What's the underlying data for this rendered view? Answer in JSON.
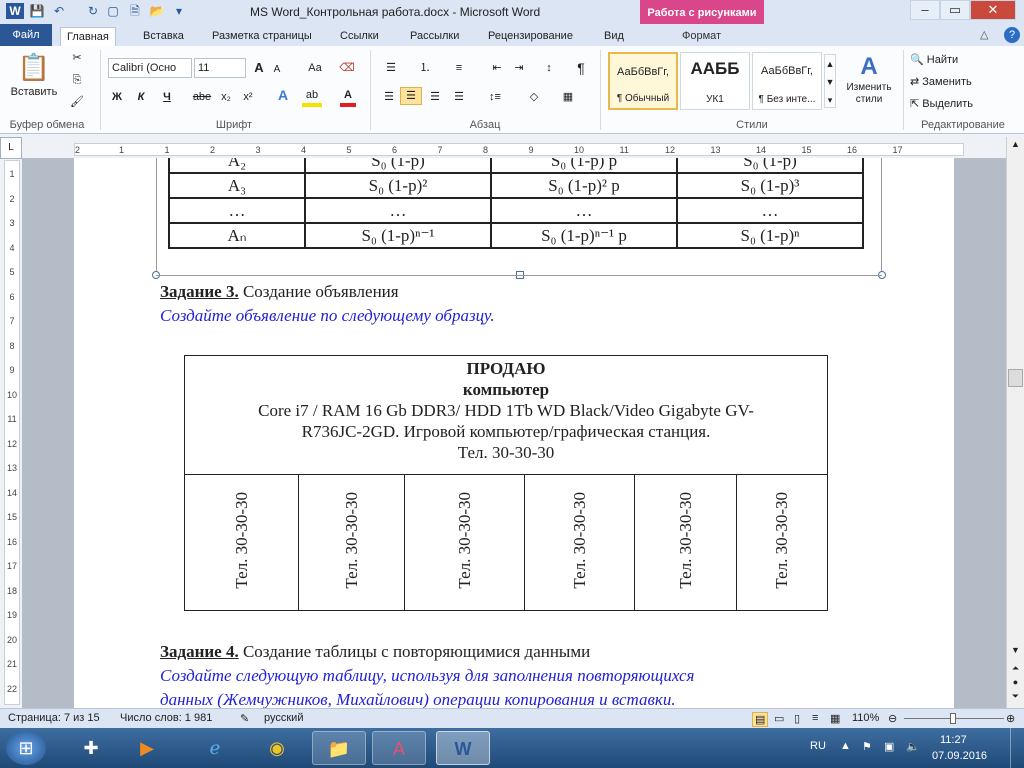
{
  "window": {
    "title": "MS Word_Контрольная работа.docx - Microsoft Word",
    "context_group": "Работа с рисунками",
    "min": "–",
    "max": "▭",
    "close": "✕"
  },
  "tabs": [
    "Файл",
    "Главная",
    "Вставка",
    "Разметка страницы",
    "Ссылки",
    "Рассылки",
    "Рецензирование",
    "Вид",
    "Формат"
  ],
  "ribbon": {
    "clipboard": {
      "label": "Буфер обмена",
      "paste": "Вставить"
    },
    "font": {
      "label": "Шрифт",
      "name": "Calibri (Осно",
      "size": "11",
      "bold": "Ж",
      "italic": "К",
      "underline": "Ч",
      "strike": "abe",
      "sub": "x₂",
      "sup": "x²",
      "case": "Aa",
      "grow": "A",
      "shrink": "A"
    },
    "paragraph": {
      "label": "Абзац",
      "pilcrow": "¶"
    },
    "styles": {
      "label": "Стили",
      "items": [
        {
          "preview": "АаБбВвГг,",
          "name": "¶ Обычный"
        },
        {
          "preview": "ААББ",
          "name": "УК1"
        },
        {
          "preview": "АаБбВвГг,",
          "name": "¶ Без инте..."
        }
      ],
      "change": "Изменить стили"
    },
    "editing": {
      "label": "Редактирование",
      "find": "Найти",
      "replace": "Заменить",
      "select": "Выделить"
    }
  },
  "ruler": {
    "corner": "L",
    "hticks": [
      "2",
      "1",
      "1",
      "2",
      "3",
      "4",
      "5",
      "6",
      "7",
      "8",
      "9",
      "10",
      "11",
      "12",
      "13",
      "14",
      "15",
      "16",
      "17"
    ],
    "vticks": [
      "1",
      "2",
      "3",
      "4",
      "5",
      "6",
      "7",
      "8",
      "9",
      "10",
      "11",
      "12",
      "13",
      "14",
      "15",
      "16",
      "17",
      "18",
      "19",
      "20",
      "21",
      "22"
    ]
  },
  "document": {
    "prev_table": [
      [
        "A₂",
        "S₀ (1-p)",
        "S₀ (1-p) p",
        "S₀ (1-p)"
      ],
      [
        "A₃",
        "S₀ (1-p)²",
        "S₀ (1-p)² p",
        "S₀ (1-p)³"
      ],
      [
        "…",
        "…",
        "…",
        "…"
      ],
      [
        "Aₙ",
        "S₀ (1-p)ⁿ⁻¹",
        "S₀ (1-p)ⁿ⁻¹ p",
        "S₀ (1-p)ⁿ"
      ]
    ],
    "task3_heading": "Задание 3.",
    "task3_title": " Создание объявления",
    "task3_instruction": "Создайте объявление по следующему  образцу.",
    "ad": {
      "line1": "ПРОДАЮ",
      "line2": "компьютер",
      "line3": "Core i7 / RAM 16 Gb DDR3/ HDD 1Tb WD Black/Video Gigabyte GV-",
      "line4": "R736JC-2GD. Игровой компьютер/графическая станция.",
      "line5": "Тел. 30-30-30",
      "tear": [
        "Тел. 30-30-30",
        "Тел. 30-30-30",
        "Тел. 30-30-30",
        "Тел. 30-30-30",
        "Тел. 30-30-30",
        "Тел. 30-30-30"
      ]
    },
    "task4_heading": "Задание 4.",
    "task4_title": " Создание таблицы с повторяющимися данными",
    "task4_line1": "Создайте следующую таблицу, используя   для    заполнения повторяющихся",
    "task4_line2": "данных  (Жемчужников, Михайлович) операции копирования и вставки."
  },
  "status": {
    "page": "Страница: 7 из 15",
    "words": "Число слов: 1 981",
    "lang": "русский",
    "zoom": "110%"
  },
  "taskbar": {
    "lang": "RU",
    "time": "11:27",
    "date": "07.09.2016"
  }
}
